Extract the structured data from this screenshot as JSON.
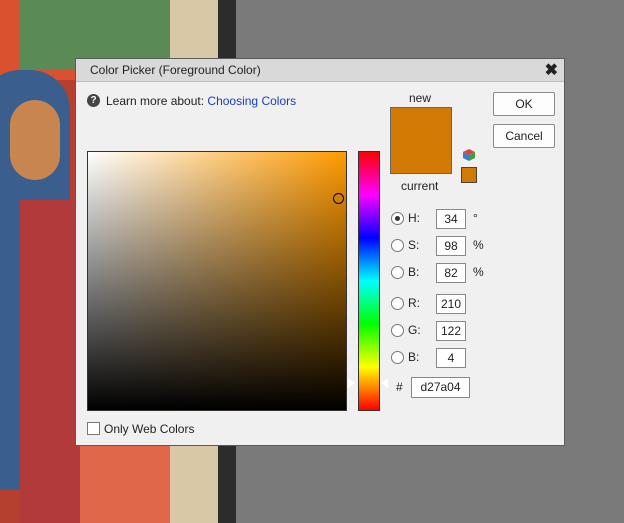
{
  "dialog": {
    "title": "Color Picker (Foreground Color)",
    "close_glyph": "✖"
  },
  "help": {
    "text": "Learn more about:",
    "link": "Choosing Colors",
    "icon_glyph": "?"
  },
  "swatches": {
    "new_label": "new",
    "current_label": "current",
    "new_color": "#d27a04",
    "current_color": "#d27a04"
  },
  "buttons": {
    "ok": "OK",
    "cancel": "Cancel"
  },
  "hsb": {
    "h": {
      "label": "H:",
      "value": "34",
      "unit": "°",
      "selected": true
    },
    "s": {
      "label": "S:",
      "value": "98",
      "unit": "%",
      "selected": false
    },
    "b": {
      "label": "B:",
      "value": "82",
      "unit": "%",
      "selected": false
    }
  },
  "rgb": {
    "r": {
      "label": "R:",
      "value": "210"
    },
    "g": {
      "label": "G:",
      "value": "122"
    },
    "b": {
      "label": "B:",
      "value": "4"
    }
  },
  "hex": {
    "label": "#",
    "value": "d27a04"
  },
  "web_only": {
    "label": "Only Web Colors",
    "checked": false
  },
  "icons": [
    "help-icon",
    "close-icon",
    "web-color-cube-icon"
  ],
  "colors": {
    "hue_base": "#ff9a00",
    "selected": "#d27a04"
  }
}
